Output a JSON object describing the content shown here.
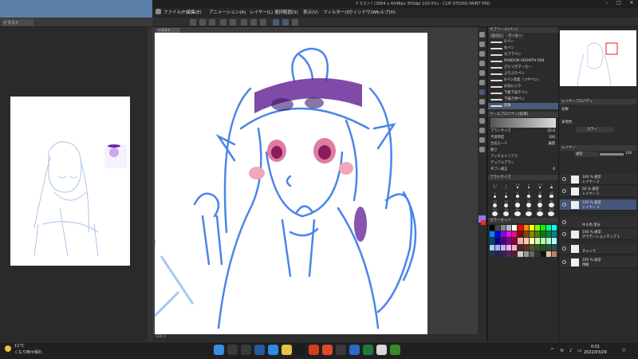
{
  "window_title": "イラスト* (3984 x 4048px 300dpi 100.0%) - CLIP STUDIO PAINT PRO",
  "menu": [
    "ファイル(F)",
    "編集(E)",
    "アニメーション(A)",
    "レイヤー(L)",
    "選択範囲(S)",
    "表示(V)",
    "フィルター(I)",
    "ウィンドウ(W)",
    "ヘルプ(H)"
  ],
  "left_tab": "イラスト",
  "brush_panel": {
    "tabs": [
      "Gペン",
      "マーカー"
    ],
    "header": "サブツール[ペン]",
    "brushes": [
      {
        "label": "Gペン",
        "selected": false
      },
      {
        "label": "丸ペン",
        "selected": false
      },
      {
        "label": "カブラペン",
        "selected": false
      },
      {
        "label": "RANDOM GROWTH PEN",
        "selected": false
      },
      {
        "label": "ざらつきマーカー",
        "selected": false
      },
      {
        "label": "ぶりぶりペン",
        "selected": false
      },
      {
        "label": "Gペン改変（つやペン）",
        "selected": false
      },
      {
        "label": "お気に入り",
        "selected": false
      },
      {
        "label": "下絵下描きペン",
        "selected": false
      },
      {
        "label": "下描き用ペン",
        "selected": false
      },
      {
        "label": "鉛筆",
        "selected": true
      }
    ]
  },
  "tool_props": {
    "header": "ツールプロパティ[鉛筆]",
    "rows": [
      {
        "label": "ブラシサイズ",
        "value": "25.0"
      },
      {
        "label": "不透明度",
        "value": "100"
      },
      {
        "label": "合成モード",
        "value": "通常"
      },
      {
        "label": "硬さ",
        "value": ""
      },
      {
        "label": "アンチエイリアス",
        "value": ""
      },
      {
        "label": "デュアルブラシ",
        "value": ""
      },
      {
        "label": "手ブレ補正",
        "value": "0"
      }
    ]
  },
  "brush_size_header": "ブラシサイズ",
  "brush_sizes": [
    "0.7",
    "1",
    "1.5",
    "2",
    "2.5",
    "3",
    "4",
    "5",
    "6",
    "7",
    "8",
    "10",
    "12",
    "15",
    "17",
    "20",
    "25",
    "30",
    "40",
    "50",
    "60",
    "70",
    "80",
    "100"
  ],
  "color_set_header": "カラーセット",
  "layer_props": {
    "header": "レイヤープロパティ",
    "effect_label": "効果",
    "color_label": "表現色",
    "color_value": "カラー"
  },
  "layer_panel_header": "レイヤー",
  "blend_mode": "通常",
  "opacity": "100",
  "layers": [
    {
      "top": "100 % 通常",
      "bottom": "レイヤー 2",
      "selected": false
    },
    {
      "top": "66 % 通常",
      "bottom": "レイヤー 1",
      "selected": false
    },
    {
      "top": "100 % 通常",
      "bottom": "レイヤー 3",
      "selected": true
    },
    {
      "top": "",
      "bottom": "ゆる色 塗分",
      "selected": false
    },
    {
      "top": "100 % 通常",
      "bottom": "グラデーションマップ 1",
      "selected": false
    },
    {
      "top": "",
      "bottom": "チェック",
      "selected": false
    },
    {
      "top": "100 % 通常",
      "bottom": "用紙",
      "selected": false
    }
  ],
  "canvas_status": "100.0",
  "weather": {
    "temp": "11°C",
    "desc": "くもり時々晴れ"
  },
  "clock": {
    "time": "0:01",
    "date": "2022/03/29"
  },
  "colors": {
    "accent": "#4a5a78",
    "sketch_blue": "#4a86e8",
    "purple": "#6a2a9a"
  }
}
